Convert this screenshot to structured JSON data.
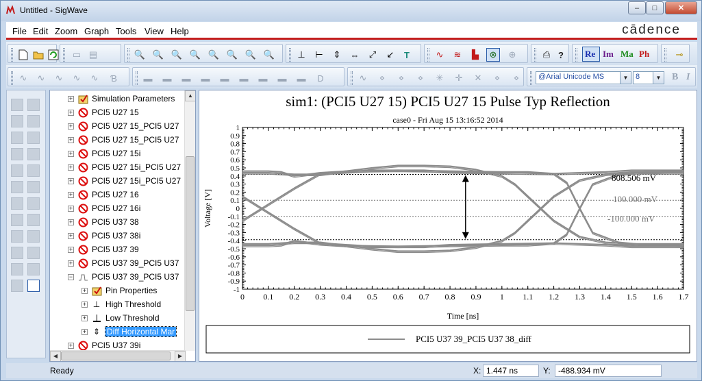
{
  "window": {
    "title": "Untitled - SigWave",
    "minimize": "–",
    "maximize": "□",
    "close": "✕"
  },
  "menu": {
    "items": [
      {
        "label": "File"
      },
      {
        "label": "Edit"
      },
      {
        "label": "Zoom"
      },
      {
        "label": "Graph"
      },
      {
        "label": "Tools"
      },
      {
        "label": "View"
      },
      {
        "label": "Help"
      }
    ],
    "brand": "cādence"
  },
  "toolbar": {
    "re": "Re",
    "im": "Im",
    "ma": "Ma",
    "ph": "Ph",
    "font_name": "@Arial Unicode MS",
    "font_size": "8",
    "bold": "B",
    "italic": "I",
    "text_tool": "T",
    "text_tool_2": "T"
  },
  "tree": {
    "items": [
      {
        "label": "Simulation Parameters",
        "icon": "simulation-parameters-icon"
      },
      {
        "label": "PCI5 U27 15",
        "icon": "no-entry-icon"
      },
      {
        "label": "PCI5 U27 15_PCI5 U27",
        "icon": "no-entry-icon"
      },
      {
        "label": "PCI5 U27 15_PCI5 U27",
        "icon": "no-entry-icon"
      },
      {
        "label": "PCI5 U27 15i",
        "icon": "no-entry-icon"
      },
      {
        "label": "PCI5 U27 15i_PCI5 U27",
        "icon": "no-entry-icon"
      },
      {
        "label": "PCI5 U27 15i_PCI5 U27",
        "icon": "no-entry-icon"
      },
      {
        "label": "PCI5 U27 16",
        "icon": "no-entry-icon"
      },
      {
        "label": "PCI5 U27 16i",
        "icon": "no-entry-icon"
      },
      {
        "label": "PCI5 U37 38",
        "icon": "no-entry-icon"
      },
      {
        "label": "PCI5 U37 38i",
        "icon": "no-entry-icon"
      },
      {
        "label": "PCI5 U37 39",
        "icon": "no-entry-icon"
      },
      {
        "label": "PCI5 U37 39_PCI5 U37",
        "icon": "no-entry-icon"
      },
      {
        "label": "PCI5 U37 39_PCI5 U37",
        "icon": "waveform-icon"
      },
      {
        "label": "Pin Properties",
        "icon": "pin-properties-icon"
      },
      {
        "label": "High Threshold",
        "icon": "high-threshold-icon"
      },
      {
        "label": "Low Threshold",
        "icon": "low-threshold-icon"
      },
      {
        "label": "Diff Horizontal Mar",
        "icon": "diff-horizontal-marker-icon"
      },
      {
        "label": "PCI5 U37 39i",
        "icon": "no-entry-icon"
      }
    ]
  },
  "plot": {
    "title": "sim1: (PCI5 U27 15) PCI5 U27 15 Pulse Typ Reflection",
    "subtitle": "case0 - Fri Aug 15 13:16:52 2014",
    "annotations": {
      "diff": "808.506 mV",
      "high": "100.000 mV",
      "low": "-100.000 mV"
    },
    "legend_label": "PCI5 U37 39_PCI5 U37 38_diff"
  },
  "chart_data": {
    "type": "line",
    "title": "sim1: (PCI5 U27 15) PCI5 U27 15 Pulse Typ Reflection",
    "subtitle": "case0 - Fri Aug 15 13:16:52 2014",
    "xlabel": "Time [ns]",
    "ylabel": "Voltage [V]",
    "xlim": [
      0,
      1.7
    ],
    "ylim": [
      -1,
      1
    ],
    "x_ticks": [
      "0",
      "0.1",
      "0.2",
      "0.3",
      "0.4",
      "0.5",
      "0.6",
      "0.7",
      "0.8",
      "0.9",
      "1",
      "1.1",
      "1.2",
      "1.3",
      "1.4",
      "1.5",
      "1.6",
      "1.7"
    ],
    "y_ticks": [
      "1",
      "0.9",
      "0.8",
      "0.7",
      "0.6",
      "0.5",
      "0.4",
      "0.3",
      "0.2",
      "0.1",
      "0",
      "-0.1",
      "-0.2",
      "-0.3",
      "-0.4",
      "-0.5",
      "-0.6",
      "-0.7",
      "-0.8",
      "-0.9",
      "-1"
    ],
    "grid": false,
    "legend_position": "bottom",
    "series": [
      {
        "name": "PCI5 U37 39_PCI5 U37 38_diff",
        "color": "#8c8c8c",
        "traces": [
          {
            "x": [
              0,
              0.05,
              0.1,
              0.2,
              0.3,
              0.5,
              0.7,
              0.8,
              1.0,
              1.2,
              1.25,
              1.3,
              1.35,
              1.45,
              1.55,
              1.6,
              1.7
            ],
            "y": [
              0.15,
              0.05,
              -0.05,
              -0.25,
              -0.43,
              -0.47,
              -0.47,
              -0.45,
              -0.44,
              -0.43,
              -0.32,
              0,
              0.3,
              0.42,
              0.45,
              0.45,
              0.46
            ]
          },
          {
            "x": [
              0,
              0.05,
              0.1,
              0.2,
              0.3,
              0.5,
              0.7,
              0.8,
              1.0,
              1.2,
              1.25,
              1.3,
              1.35,
              1.45,
              1.55,
              1.6,
              1.7
            ],
            "y": [
              -0.15,
              -0.05,
              0.05,
              0.25,
              0.43,
              0.47,
              0.47,
              0.45,
              0.44,
              0.43,
              0.32,
              0,
              -0.3,
              -0.42,
              -0.45,
              -0.45,
              -0.46
            ]
          },
          {
            "x": [
              0,
              0.1,
              0.2,
              0.3,
              0.5,
              0.6,
              0.7,
              0.8,
              0.9,
              1.0,
              1.05,
              1.1,
              1.2,
              1.3,
              1.4,
              1.5,
              1.7
            ],
            "y": [
              0.44,
              0.44,
              0.42,
              0.42,
              0.5,
              0.53,
              0.53,
              0.52,
              0.48,
              0.4,
              0.3,
              0.15,
              -0.15,
              -0.35,
              -0.42,
              -0.44,
              -0.44
            ]
          },
          {
            "x": [
              0,
              0.1,
              0.2,
              0.3,
              0.5,
              0.6,
              0.7,
              0.8,
              0.9,
              1.0,
              1.05,
              1.1,
              1.2,
              1.3,
              1.4,
              1.5,
              1.7
            ],
            "y": [
              -0.44,
              -0.44,
              -0.42,
              -0.42,
              -0.5,
              -0.53,
              -0.53,
              -0.52,
              -0.48,
              -0.4,
              -0.3,
              -0.15,
              0.15,
              0.35,
              0.42,
              0.44,
              0.44
            ]
          },
          {
            "x": [
              0,
              0.1,
              0.15,
              0.2,
              0.3,
              0.4,
              0.6,
              0.8,
              1.0,
              1.1,
              1.2,
              1.3,
              1.4,
              1.5,
              1.7
            ],
            "y": [
              0.46,
              0.46,
              0.45,
              0.4,
              0.44,
              0.46,
              0.47,
              0.46,
              0.45,
              0.45,
              0.43,
              0.44,
              0.45,
              0.47,
              0.47
            ]
          },
          {
            "x": [
              0,
              0.1,
              0.15,
              0.2,
              0.3,
              0.4,
              0.6,
              0.8,
              1.0,
              1.1,
              1.2,
              1.3,
              1.4,
              1.5,
              1.7
            ],
            "y": [
              -0.46,
              -0.46,
              -0.45,
              -0.4,
              -0.44,
              -0.46,
              -0.47,
              -0.46,
              -0.45,
              -0.45,
              -0.43,
              -0.44,
              -0.45,
              -0.47,
              -0.47
            ]
          }
        ]
      }
    ],
    "markers": {
      "diff_upper": 0.42,
      "diff_lower": -0.388,
      "diff_x": 0.86,
      "high_threshold": 0.1,
      "low_threshold": -0.1
    }
  },
  "status": {
    "ready": "Ready",
    "x_label": "X:",
    "x_value": "1.447 ns",
    "y_label": "Y:",
    "y_value": "-488.934 mV"
  }
}
